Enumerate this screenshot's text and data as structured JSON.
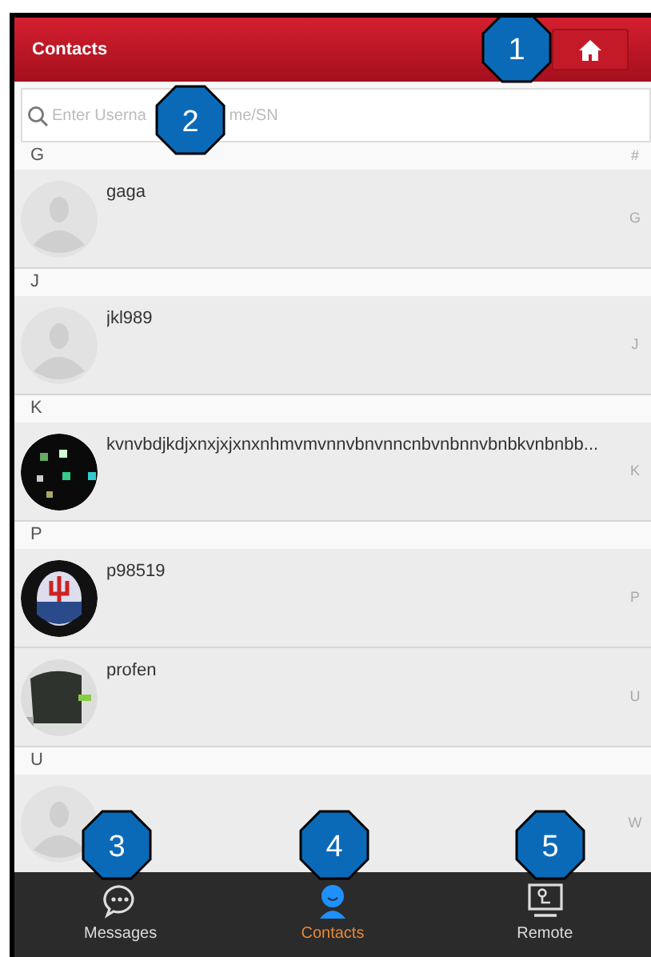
{
  "header": {
    "title": "Contacts"
  },
  "search": {
    "placeholder": "Enter Userna",
    "placeholder_tail": "me/SN"
  },
  "sections": [
    {
      "letter": "G",
      "index": "#",
      "contacts": [
        {
          "name": "gaga",
          "kind": "default",
          "index": "G"
        }
      ]
    },
    {
      "letter": "J",
      "contacts": [
        {
          "name": "jkl989",
          "kind": "default",
          "index": "J"
        }
      ]
    },
    {
      "letter": "K",
      "contacts": [
        {
          "name": "kvnvbdjkdjxnxjxjxnxnhmvmvnnvbnvnncnbvnbnnvbnbkvnbnbb...",
          "kind": "picture",
          "index": "K"
        }
      ]
    },
    {
      "letter": "P",
      "contacts": [
        {
          "name": "p98519",
          "kind": "picture",
          "index": "P"
        },
        {
          "name": "profen",
          "kind": "picture",
          "index": "U"
        }
      ]
    },
    {
      "letter": "U",
      "contacts": [
        {
          "kind": "default",
          "index": "W"
        }
      ]
    }
  ],
  "tabs": [
    {
      "label": "Messages",
      "selected": false
    },
    {
      "label": "Contacts",
      "selected": true
    },
    {
      "label": "Remote",
      "selected": false
    }
  ],
  "callouts": [
    "1",
    "2",
    "3",
    "4",
    "5"
  ]
}
